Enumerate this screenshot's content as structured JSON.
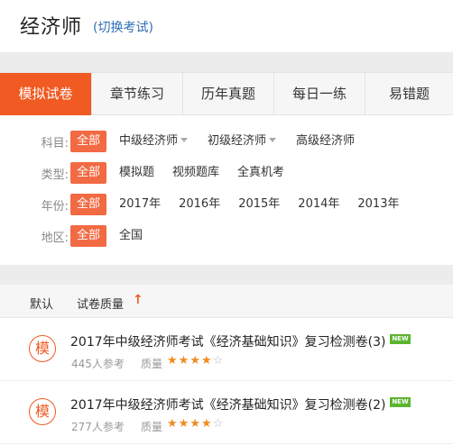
{
  "header": {
    "title": "经济师",
    "switch_label": "(切换考试)"
  },
  "tabs": [
    {
      "label": "模拟试卷",
      "active": true
    },
    {
      "label": "章节练习"
    },
    {
      "label": "历年真题"
    },
    {
      "label": "每日一练"
    },
    {
      "label": "易错题"
    }
  ],
  "filters": {
    "subject": {
      "label": "科目:",
      "all": "全部",
      "options": [
        "中级经济师",
        "初级经济师",
        "高级经济师"
      ]
    },
    "type": {
      "label": "类型:",
      "all": "全部",
      "options": [
        "模拟题",
        "视频题库",
        "全真机考"
      ]
    },
    "year": {
      "label": "年份:",
      "all": "全部",
      "options": [
        "2017年",
        "2016年",
        "2015年",
        "2014年",
        "2013年"
      ]
    },
    "region": {
      "label": "地区:",
      "all": "全部",
      "options": [
        "全国"
      ]
    }
  },
  "sort": {
    "default_label": "默认",
    "quality_label": "试卷质量",
    "arrow": "↑"
  },
  "exams": [
    {
      "badge": "模",
      "title": "2017年中级经济师考试《经济基础知识》复习检测卷(3)",
      "new_tag": "NEW",
      "participants": "445人参考",
      "quality_label": "质量",
      "rating": 4,
      "max_rating": 5
    },
    {
      "badge": "模",
      "title": "2017年中级经济师考试《经济基础知识》复习检测卷(2)",
      "new_tag": "NEW",
      "participants": "277人参考",
      "quality_label": "质量",
      "rating": 4,
      "max_rating": 5
    }
  ],
  "colors": {
    "accent": "#f15a22",
    "chip": "#f26a43",
    "link": "#2f6fb5",
    "star": "#f08a1e",
    "new_badge": "#5cb531"
  }
}
